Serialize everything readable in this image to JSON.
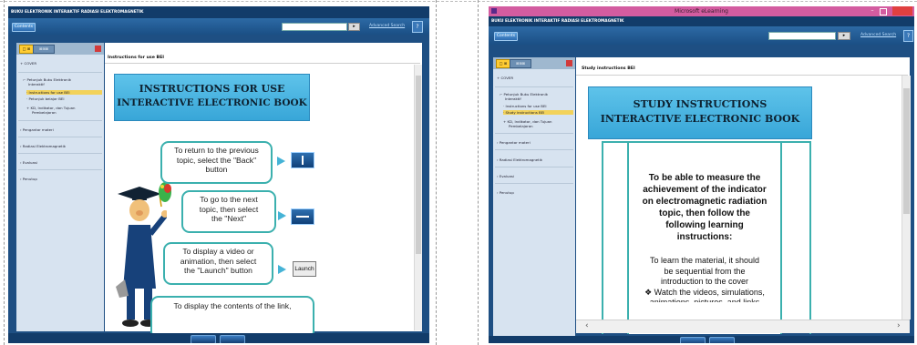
{
  "left": {
    "app_title": "BUKU ELEKTRONIK INTERAKTIF RADIASI ELEKTROMAGNETIK",
    "contents_button": "Contents",
    "search_value": "",
    "advanced_search": "Advanced Search",
    "help": "?",
    "tab_labels": [
      "□ ⊞",
      "⊞⊞⊞"
    ],
    "nav_items": [
      {
        "label": "+ COVER"
      },
      {
        "label": "⌐ Petunjuk Buku Elektronik"
      },
      {
        "label": "Interaktif"
      },
      {
        "label": "· Instructions for use BEI"
      },
      {
        "label": "· Petunjuk belajar BEI"
      },
      {
        "label": "+ KD, Indikator, dan Tujuan"
      },
      {
        "label": "Pembelajaran"
      },
      {
        "label": "› Pengantar materi"
      },
      {
        "label": "› Radiasi Elektromagnetik"
      },
      {
        "label": "› Evaluasi"
      },
      {
        "label": "› Penutup"
      }
    ],
    "content_heading": "Instructions for use BEI",
    "title_line1": "INSTRUCTIONS FOR USE",
    "title_line2": "INTERACTIVE ELECTRONIC BOOK",
    "bubbles": [
      {
        "lines": [
          "To return to the previous",
          "topic, select the \"Back\"",
          "button"
        ]
      },
      {
        "lines": [
          "To go to the next",
          "topic, then select",
          "the \"Next\""
        ]
      },
      {
        "lines": [
          "To display a video or",
          "animation, then select",
          "the \"Launch\" button"
        ]
      },
      {
        "lines": [
          "To display the contents of the link,"
        ]
      }
    ],
    "launch_label": "Launch"
  },
  "right": {
    "window_title": "Microsoft eLearning",
    "app_title": "BUKU ELEKTRONIK INTERAKTIF RADIASI ELEKTROMAGNETIK",
    "contents_button": "Contents",
    "search_value": "",
    "advanced_search": "Advanced Search",
    "help": "?",
    "tab_labels": [
      "□ ⊞",
      "⊞⊞⊞"
    ],
    "nav_items": [
      {
        "label": "+ COVER"
      },
      {
        "label": "⌐ Petunjuk Buku Elektronik"
      },
      {
        "label": "Interaktif"
      },
      {
        "label": "· Instructions for use BEI"
      },
      {
        "label": "· Study instructions BEI"
      },
      {
        "label": "+ KD, Indikator, dan Tujuan"
      },
      {
        "label": "Pembelajaran"
      },
      {
        "label": "› Pengantar materi"
      },
      {
        "label": "› Radiasi Elektromagnetik"
      },
      {
        "label": "› Evaluasi"
      },
      {
        "label": "› Penutup"
      }
    ],
    "content_heading": "Study instructions BEI",
    "title_line1": "STUDY INSTRUCTIONS",
    "title_line2": "INTERACTIVE ELECTRONIC BOOK",
    "panel_lines": [
      "To be able to measure the",
      "achievement of the indicator",
      "on electromagnetic radiation",
      "topic, then follow the",
      "following learning",
      "instructions:"
    ],
    "panel_lines2": [
      "To learn the material, it should",
      "be sequential from the",
      "introduction to the cover"
    ],
    "panel_bullet": "❖ Watch the videos, simulations,",
    "panel_cut": "animations, pictures, and links"
  }
}
